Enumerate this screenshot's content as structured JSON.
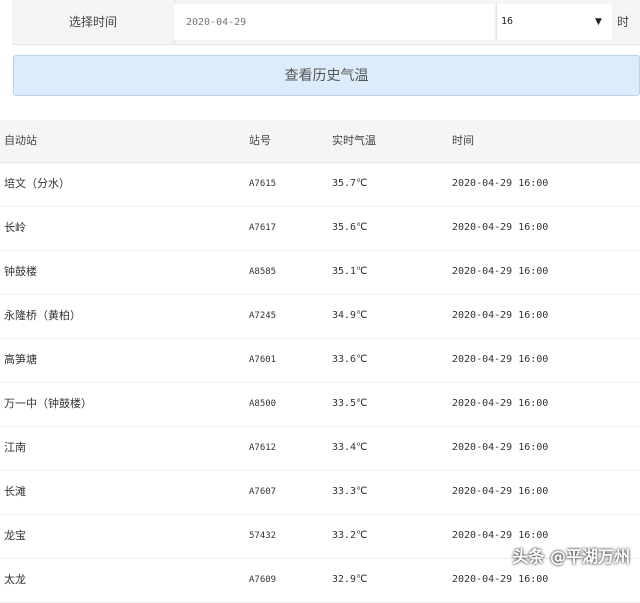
{
  "filter": {
    "time_label": "选择时间",
    "date_value": "2020-04-29",
    "hour_value": "16",
    "hour_unit": "时",
    "caret": "▼"
  },
  "history_button": "查看历史气温",
  "table": {
    "headers": [
      "自动站",
      "站号",
      "实时气温",
      "时间"
    ],
    "rows": [
      [
        "培文（分水）",
        "A7615",
        "35.7℃",
        "2020-04-29 16:00"
      ],
      [
        "长岭",
        "A7617",
        "35.6℃",
        "2020-04-29 16:00"
      ],
      [
        "钟鼓楼",
        "A8585",
        "35.1℃",
        "2020-04-29 16:00"
      ],
      [
        "永隆桥（黄柏）",
        "A7245",
        "34.9℃",
        "2020-04-29 16:00"
      ],
      [
        "高笋塘",
        "A7601",
        "33.6℃",
        "2020-04-29 16:00"
      ],
      [
        "万一中（钟鼓楼）",
        "A8500",
        "33.5℃",
        "2020-04-29 16:00"
      ],
      [
        "江南",
        "A7612",
        "33.4℃",
        "2020-04-29 16:00"
      ],
      [
        "长滩",
        "A7607",
        "33.3℃",
        "2020-04-29 16:00"
      ],
      [
        "龙宝",
        "57432",
        "33.2℃",
        "2020-04-29 16:00"
      ],
      [
        "太龙",
        "A7609",
        "32.9℃",
        "2020-04-29 16:00"
      ]
    ]
  },
  "watermark": "头条 @平湖万州"
}
